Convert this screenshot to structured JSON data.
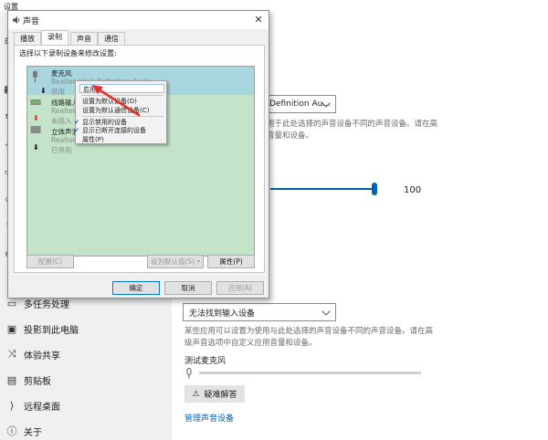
{
  "settings": {
    "window_title": "设置",
    "sidebar_stubs": [
      "命",
      "新",
      "↻",
      "◁",
      "▭",
      "◇",
      "?",
      "⊕",
      "▯",
      "⊙",
      "⊘"
    ],
    "sidebar_items": [
      {
        "icon": "multitask-icon",
        "label": "多任务处理"
      },
      {
        "icon": "project-icon",
        "label": "投影到此电脑"
      },
      {
        "icon": "share-icon",
        "label": "体验共享"
      },
      {
        "icon": "clipboard-icon",
        "label": "剪贴板"
      },
      {
        "icon": "remote-desktop-icon",
        "label": "远程桌面"
      },
      {
        "icon": "info-icon",
        "label": "关于"
      }
    ],
    "output_device": "Definition Au...",
    "output_desc_line1": "用于此处选择的声音设备不同的声音设备。请在高",
    "output_desc_line2": "音量和设备。",
    "volume_value": "100",
    "input_device": "无法找到输入设备",
    "input_desc_line1": "某些应用可以设置为使用与此处选择的声音设备不同的声音设备。请在高",
    "input_desc_line2": "级声音选项中自定义应用音量和设备。",
    "mic_test_label": "测试麦克风",
    "troubleshoot_label": "疑难解答",
    "manage_devices_link": "管理声音设备"
  },
  "dialog": {
    "title": "声音",
    "tabs": [
      "播放",
      "录制",
      "声音",
      "通信"
    ],
    "active_tab": "录制",
    "instruction": "选择以下录制设备来修改设置:",
    "devices": [
      {
        "name": "麦克风",
        "sub": "Realtek High Definition Audio",
        "status": "禁用"
      },
      {
        "name": "线路输入",
        "sub": "Realtek",
        "status": "未插入"
      },
      {
        "name": "立体声混",
        "sub": "Realtek",
        "status": "已停用"
      }
    ],
    "configure_label": "配置(C)",
    "set_default_label": "设为默认值(S)",
    "properties_label": "属性(P)",
    "ok_label": "确定",
    "cancel_label": "取消",
    "apply_label": "应用(A)"
  },
  "context_menu": {
    "items": [
      {
        "label": "启用",
        "checked": false,
        "highlighted": true
      },
      {
        "label": "设置为默认设备(D)",
        "checked": false,
        "highlighted": false
      },
      {
        "label": "设置为默认通信设备(C)",
        "checked": false,
        "highlighted": false
      },
      {
        "label": "显示禁用的设备",
        "checked": true,
        "highlighted": false
      },
      {
        "label": "显示已断开连接的设备",
        "checked": true,
        "highlighted": false
      },
      {
        "label": "属性(P)",
        "checked": false,
        "highlighted": false
      }
    ]
  },
  "colors": {
    "accent": "#0063b1",
    "annotation_arrow": "#e0312b",
    "device_list_bg": "#c3e4c8",
    "device_selected_bg": "#a8d6de"
  }
}
